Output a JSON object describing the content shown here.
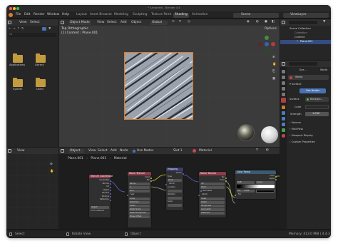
{
  "window": {
    "title": "* (Unsaved) - Blender 4.4"
  },
  "topbar": {
    "menus": [
      "File",
      "Edit",
      "Render",
      "Window",
      "Help"
    ],
    "workspaces": [
      "Layout",
      "Asset Browser",
      "Modeling",
      "Sculpting",
      "Texture Paint",
      "Shading",
      "Animation"
    ],
    "active_workspace": "Shading",
    "scene_label": "Scene",
    "view_layer_label": "ViewLayer"
  },
  "file_browser": {
    "view_label": "View",
    "select_label": "Select",
    "folders": [
      "Applications",
      "Library",
      "System",
      "Users"
    ],
    "view_menu_label": "View"
  },
  "viewport": {
    "mode_label": "Object Mode",
    "menus": [
      "View",
      "Select",
      "Add",
      "Object"
    ],
    "transform_label": "Global",
    "overlay_title": "Top Orthographic",
    "overlay_sub": "(1) Content | Plane.001",
    "options_label": "Options"
  },
  "outliner": {
    "items": [
      "Scene Collection",
      "Collection",
      "Content",
      "Plane.001"
    ]
  },
  "properties": {
    "world_header": "Sce...",
    "world_label": "World",
    "world_name": "World",
    "surface_section": "Surface",
    "use_nodes_label": "Use Nodes",
    "surface_label": "Surface",
    "surface_value": "Backgro...",
    "color_label": "Color",
    "strength_label": "Strength",
    "strength_value": "1.000",
    "sections": [
      "Volume",
      "Mist Pass",
      "Viewport Display",
      "Custom Properties"
    ]
  },
  "node_editor": {
    "header_items": [
      "Object",
      "View",
      "Select",
      "Add",
      "Node"
    ],
    "use_nodes_label": "Use Nodes",
    "slot_label": "Slot 1",
    "material_label": "Material",
    "breadcrumb": [
      "Plane.001",
      "Plane.001",
      "Material"
    ],
    "nodes": [
      {
        "title": "Texture Coordinate",
        "rows": [
          "Generated",
          "Normal",
          "UV",
          "Object",
          "Camera",
          "Window",
          "Reflection"
        ],
        "extra": [
          "Object",
          "From Instancer"
        ]
      },
      {
        "title": "Wave Texture",
        "rows": [
          "Color",
          "Fac",
          "Bands",
          "X",
          "Sine",
          "Saw",
          "Scale",
          "Distortion",
          "Detail",
          "Detail Scale",
          "Detail Roughness",
          "Phase Offset"
        ]
      },
      {
        "title": "Mapping",
        "rows": [
          "Vector",
          "Type",
          "Point",
          "Vector",
          "Location",
          "Rotation",
          "Scale"
        ]
      },
      {
        "title": "Noise Texture",
        "rows": [
          "Fac",
          "Color",
          "3D",
          "Perlin",
          "Normalize",
          "Vector",
          "Scale",
          "Detail",
          "Roughness",
          "Lacunarity",
          "Distortion"
        ]
      },
      {
        "title": "Color Ramp",
        "rows": [
          "Color",
          "Alpha",
          "RGB",
          "Linear",
          "Fac"
        ],
        "pos_label": "Pos",
        "pos_value": "0.082"
      }
    ],
    "side_icons": [
      "hand-icon",
      "camera-icon"
    ]
  },
  "statusbar": {
    "select": "Select",
    "rotate_view": "Rotate View",
    "object": "Object",
    "memory": "Memory: 413.0 MiB | 4.4.3"
  },
  "colors": {
    "accent_orange": "#e27b1f",
    "accent_blue": "#4772b3",
    "node_tex": "#8b3b4b",
    "node_vec": "#3b3b73",
    "node_conv": "#3b5a73"
  }
}
